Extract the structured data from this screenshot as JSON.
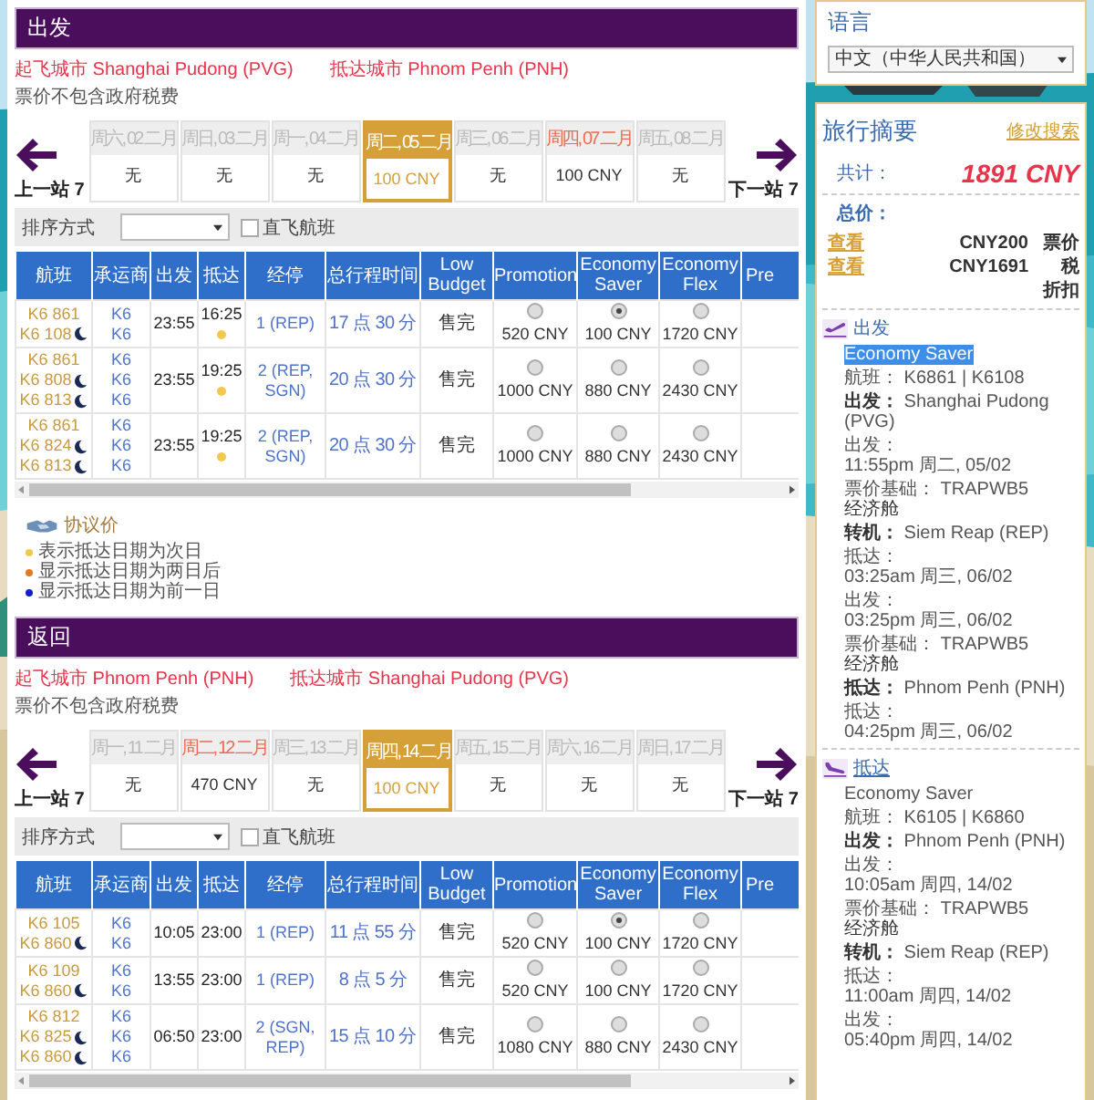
{
  "sections": [
    {
      "title": "出发",
      "origin": "起飞城市 Shanghai Pudong (PVG)",
      "destination": "抵达城市 Phnom Penh (PNH)",
      "note": "票价不包含政府税费",
      "prev": "上一站 7",
      "next": "下一站 7",
      "days": [
        {
          "label": "周六, 02 二月",
          "price": "无",
          "available": false,
          "selected": false
        },
        {
          "label": "周日, 03 二月",
          "price": "无",
          "available": false,
          "selected": false
        },
        {
          "label": "周一, 04 二月",
          "price": "无",
          "available": false,
          "selected": false
        },
        {
          "label": "周二, 05 二月",
          "price": "100 CNY",
          "available": true,
          "selected": true
        },
        {
          "label": "周三, 06 二月",
          "price": "无",
          "available": false,
          "selected": false
        },
        {
          "label": "周四, 07 二月",
          "price": "100 CNY",
          "available": true,
          "selected": false
        },
        {
          "label": "周五, 08 二月",
          "price": "无",
          "available": false,
          "selected": false
        }
      ],
      "sort": {
        "label": "排序方式",
        "direct_label": "直飞航班",
        "direct_checked": false
      },
      "columns": [
        "航班",
        "承运商",
        "出发",
        "抵达",
        "经停",
        "总行程时间",
        "Low Budget",
        "Promotion",
        "Economy Saver",
        "Economy Flex",
        "Pre"
      ],
      "rows": [
        {
          "flights": [
            {
              "number": "K6 861",
              "overnight": false
            },
            {
              "number": "K6 108",
              "overnight": true
            }
          ],
          "carriers": [
            "K6",
            "K6"
          ],
          "depart": "23:55",
          "arrive": "16:25",
          "next_day": true,
          "stops": "1 (REP)",
          "duration": "17 点 30 分",
          "low_budget": "售完",
          "fares": [
            {
              "price": "520 CNY",
              "selected": false
            },
            {
              "price": "100 CNY",
              "selected": true
            },
            {
              "price": "1720 CNY",
              "selected": false
            }
          ]
        },
        {
          "flights": [
            {
              "number": "K6 861",
              "overnight": false
            },
            {
              "number": "K6 808",
              "overnight": true
            },
            {
              "number": "K6 813",
              "overnight": true
            }
          ],
          "carriers": [
            "K6",
            "K6",
            "K6"
          ],
          "depart": "23:55",
          "arrive": "19:25",
          "next_day": true,
          "stops": "2 (REP, SGN)",
          "duration": "20 点 30 分",
          "low_budget": "售完",
          "fares": [
            {
              "price": "1000 CNY",
              "selected": false
            },
            {
              "price": "880 CNY",
              "selected": false
            },
            {
              "price": "2430 CNY",
              "selected": false
            }
          ]
        },
        {
          "flights": [
            {
              "number": "K6 861",
              "overnight": false
            },
            {
              "number": "K6 824",
              "overnight": true
            },
            {
              "number": "K6 813",
              "overnight": true
            }
          ],
          "carriers": [
            "K6",
            "K6",
            "K6"
          ],
          "depart": "23:55",
          "arrive": "19:25",
          "next_day": true,
          "stops": "2 (REP, SGN)",
          "duration": "20 点 30 分",
          "low_budget": "售完",
          "fares": [
            {
              "price": "1000 CNY",
              "selected": false
            },
            {
              "price": "880 CNY",
              "selected": false
            },
            {
              "price": "2430 CNY",
              "selected": false
            }
          ]
        }
      ],
      "legend": {
        "title": "协议价",
        "items": [
          {
            "text": "表示抵达日期为次日",
            "color": "#f2c94c"
          },
          {
            "text": "显示抵达日期为两日后",
            "color": "#e07a20"
          },
          {
            "text": "显示抵达日期为前一日",
            "color": "#1020d0"
          }
        ]
      }
    },
    {
      "title": "返回",
      "origin": "起飞城市 Phnom Penh (PNH)",
      "destination": "抵达城市 Shanghai Pudong (PVG)",
      "note": "票价不包含政府税费",
      "prev": "上一站 7",
      "next": "下一站 7",
      "days": [
        {
          "label": "周一, 11 二月",
          "price": "无",
          "available": false,
          "selected": false
        },
        {
          "label": "周二, 12 二月",
          "price": "470 CNY",
          "available": true,
          "selected": false
        },
        {
          "label": "周三, 13 二月",
          "price": "无",
          "available": false,
          "selected": false
        },
        {
          "label": "周四, 14 二月",
          "price": "100 CNY",
          "available": true,
          "selected": true
        },
        {
          "label": "周五, 15 二月",
          "price": "无",
          "available": false,
          "selected": false
        },
        {
          "label": "周六, 16 二月",
          "price": "无",
          "available": false,
          "selected": false
        },
        {
          "label": "周日, 17 二月",
          "price": "无",
          "available": false,
          "selected": false
        }
      ],
      "sort": {
        "label": "排序方式",
        "direct_label": "直飞航班",
        "direct_checked": false
      },
      "columns": [
        "航班",
        "承运商",
        "出发",
        "抵达",
        "经停",
        "总行程时间",
        "Low Budget",
        "Promotion",
        "Economy Saver",
        "Economy Flex",
        "Pre"
      ],
      "rows": [
        {
          "flights": [
            {
              "number": "K6 105",
              "overnight": false
            },
            {
              "number": "K6 860",
              "overnight": true
            }
          ],
          "carriers": [
            "K6",
            "K6"
          ],
          "depart": "10:05",
          "arrive": "23:00",
          "next_day": false,
          "stops": "1 (REP)",
          "duration": "11 点 55 分",
          "low_budget": "售完",
          "fares": [
            {
              "price": "520 CNY",
              "selected": false
            },
            {
              "price": "100 CNY",
              "selected": true
            },
            {
              "price": "1720 CNY",
              "selected": false
            }
          ]
        },
        {
          "flights": [
            {
              "number": "K6 109",
              "overnight": false
            },
            {
              "number": "K6 860",
              "overnight": true
            }
          ],
          "carriers": [
            "K6",
            "K6"
          ],
          "depart": "13:55",
          "arrive": "23:00",
          "next_day": false,
          "stops": "1 (REP)",
          "duration": "8 点 5 分",
          "low_budget": "售完",
          "fares": [
            {
              "price": "520 CNY",
              "selected": false
            },
            {
              "price": "100 CNY",
              "selected": false
            },
            {
              "price": "1720 CNY",
              "selected": false
            }
          ]
        },
        {
          "flights": [
            {
              "number": "K6 812",
              "overnight": false
            },
            {
              "number": "K6 825",
              "overnight": true
            },
            {
              "number": "K6 860",
              "overnight": true
            }
          ],
          "carriers": [
            "K6",
            "K6",
            "K6"
          ],
          "depart": "06:50",
          "arrive": "23:00",
          "next_day": false,
          "stops": "2 (SGN, REP)",
          "duration": "15 点 10 分",
          "low_budget": "售完",
          "fares": [
            {
              "price": "1080 CNY",
              "selected": false
            },
            {
              "price": "880 CNY",
              "selected": false
            },
            {
              "price": "2430 CNY",
              "selected": false
            }
          ]
        }
      ]
    }
  ],
  "sidebar": {
    "language": {
      "title": "语言",
      "value": "中文（中华人民共和国）"
    },
    "summary": {
      "title": "旅行摘要",
      "modify": "修改搜索",
      "total_label": "共计：",
      "total": "1891 CNY",
      "price_title": "总价：",
      "price_rows": [
        {
          "link": "查看",
          "amount": "CNY200",
          "label": "票价"
        },
        {
          "link": "查看",
          "amount": "CNY1691",
          "label": "税"
        },
        {
          "label": "折扣"
        }
      ],
      "legs": [
        {
          "kind": "depart",
          "title": "出发",
          "link": false,
          "fare": "Economy Saver",
          "fare_highlighted": true,
          "lines": [
            {
              "kind": "info",
              "label": "航班：",
              "value": "K6861 | K6108"
            },
            {
              "kind": "place",
              "label": "出发：",
              "value": "Shanghai Pudong (PVG)"
            },
            {
              "kind": "stack",
              "label": "出发：",
              "value": "11:55pm 周二, 05/02"
            },
            {
              "kind": "basis",
              "label": "票价基础：",
              "value": "TRAPWB5",
              "cabin": "经济舱"
            },
            {
              "kind": "place",
              "label": "转机：",
              "value": "Siem Reap (REP)"
            },
            {
              "kind": "stack",
              "label": "抵达：",
              "value": "03:25am 周三, 06/02"
            },
            {
              "kind": "stack",
              "label": "出发：",
              "value": "03:25pm 周三, 06/02"
            },
            {
              "kind": "basis",
              "label": "票价基础：",
              "value": "TRAPWB5",
              "cabin": "经济舱"
            },
            {
              "kind": "place",
              "label": "抵达：",
              "value": "Phnom Penh (PNH)"
            },
            {
              "kind": "stack",
              "label": "抵达：",
              "value": "04:25pm 周三, 06/02"
            }
          ]
        },
        {
          "kind": "arrive",
          "title": "抵达",
          "link": true,
          "fare": "Economy Saver",
          "fare_highlighted": false,
          "lines": [
            {
              "kind": "info",
              "label": "航班：",
              "value": "K6105 | K6860"
            },
            {
              "kind": "place",
              "label": "出发：",
              "value": "Phnom Penh (PNH)"
            },
            {
              "kind": "stack",
              "label": "出发：",
              "value": "10:05am 周四, 14/02"
            },
            {
              "kind": "basis",
              "label": "票价基础：",
              "value": "TRAPWB5",
              "cabin": "经济舱"
            },
            {
              "kind": "place",
              "label": "转机：",
              "value": "Siem Reap (REP)"
            },
            {
              "kind": "stack",
              "label": "抵达：",
              "value": "11:00am 周四, 14/02"
            },
            {
              "kind": "stack",
              "label": "出发：",
              "value": "05:40pm 周四, 14/02"
            }
          ]
        }
      ]
    }
  }
}
